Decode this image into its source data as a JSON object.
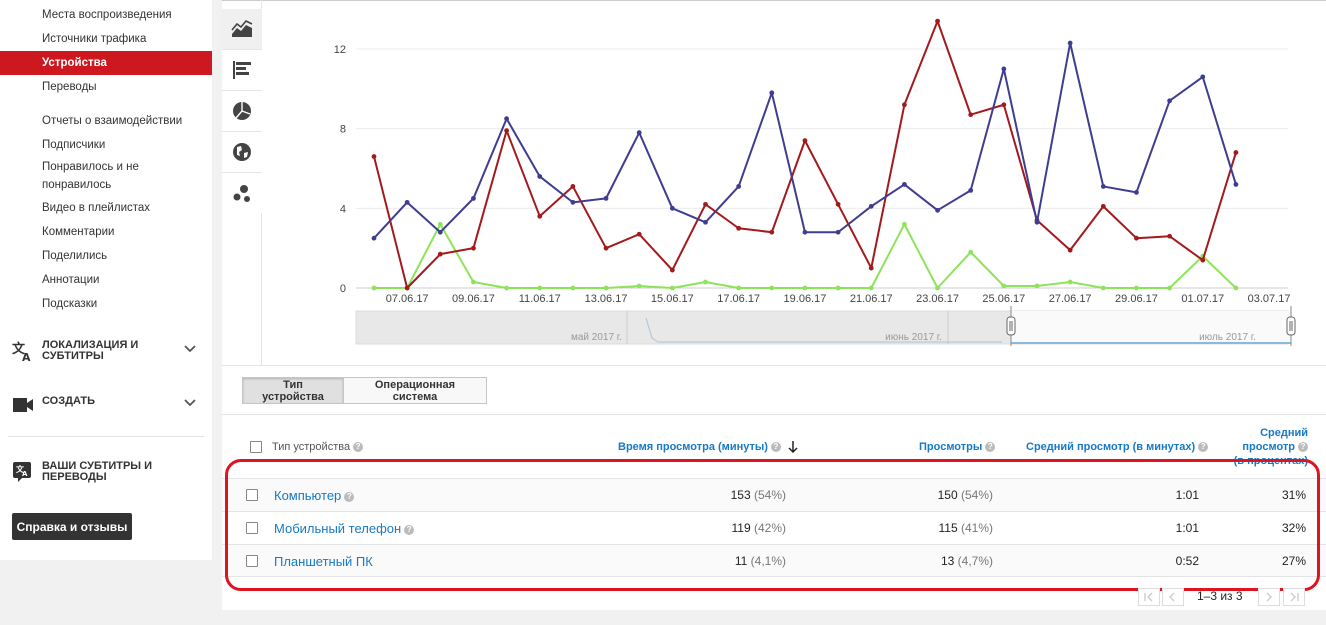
{
  "sidebar": {
    "items_top": [
      {
        "label": "Места воспроизведения"
      },
      {
        "label": "Источники трафика"
      },
      {
        "label": "Устройства"
      },
      {
        "label": "Переводы"
      }
    ],
    "engagement_heading": "Отчеты о взаимодействии",
    "engagement_items": [
      {
        "label": "Подписчики"
      },
      {
        "label": "Понравилось и не понравилось"
      },
      {
        "label": "Видео в плейлистах"
      },
      {
        "label": "Комментарии"
      },
      {
        "label": "Поделились"
      },
      {
        "label": "Аннотации"
      },
      {
        "label": "Подсказки"
      }
    ],
    "sections": [
      {
        "label": "Локализация и субтитры",
        "icon": "translate-icon"
      },
      {
        "label": "Создать",
        "icon": "video-camera-icon"
      },
      {
        "label": "Ваши субтитры и переводы",
        "icon": "subtitles-translate-icon"
      }
    ],
    "help_button": "Справка и отзывы"
  },
  "view_tabs": [
    "line-chart-icon",
    "bar-chart-icon",
    "pie-chart-icon",
    "globe-icon",
    "bubble-chart-icon"
  ],
  "chart_data": {
    "type": "line",
    "x": [
      "06.06.17",
      "07.06.17",
      "08.06.17",
      "09.06.17",
      "10.06.17",
      "11.06.17",
      "12.06.17",
      "13.06.17",
      "14.06.17",
      "15.06.17",
      "16.06.17",
      "17.06.17",
      "18.06.17",
      "19.06.17",
      "20.06.17",
      "21.06.17",
      "22.06.17",
      "23.06.17",
      "24.06.17",
      "25.06.17",
      "26.06.17",
      "27.06.17",
      "28.06.17",
      "29.06.17",
      "30.06.17",
      "01.07.17",
      "02.07.17",
      "03.07.17"
    ],
    "xticks": [
      "07.06.17",
      "09.06.17",
      "11.06.17",
      "13.06.17",
      "15.06.17",
      "17.06.17",
      "19.06.17",
      "21.06.17",
      "23.06.17",
      "25.06.17",
      "27.06.17",
      "29.06.17",
      "01.07.17",
      "03.07.17"
    ],
    "yticks": [
      0,
      4,
      8,
      12
    ],
    "ylim": [
      0,
      13.5
    ],
    "grid": true,
    "series": [
      {
        "color": "#3f3d8f",
        "values": [
          2.5,
          4.3,
          2.8,
          4.5,
          8.5,
          5.6,
          4.3,
          4.5,
          7.8,
          4.0,
          3.3,
          5.1,
          9.8,
          2.8,
          2.8,
          4.1,
          5.2,
          3.9,
          4.9,
          11.0,
          3.3,
          12.3,
          5.1,
          4.8,
          9.4,
          10.6,
          5.2
        ]
      },
      {
        "color": "#a31a1d",
        "values": [
          6.6,
          0,
          1.7,
          2.0,
          7.9,
          3.6,
          5.1,
          2.0,
          2.7,
          0.9,
          4.2,
          3.0,
          2.8,
          7.4,
          4.2,
          1.0,
          9.2,
          13.4,
          8.7,
          9.2,
          3.4,
          1.9,
          4.1,
          2.5,
          2.6,
          1.4,
          6.8
        ]
      },
      {
        "color": "#8fe35a",
        "values": [
          0,
          0,
          3.2,
          0.3,
          0,
          0,
          0,
          0,
          0.1,
          0,
          0.3,
          0,
          0,
          0,
          0,
          0,
          3.2,
          0,
          1.8,
          0.1,
          0.1,
          0.3,
          0,
          0,
          0,
          1.6,
          0
        ]
      }
    ],
    "navigator_labels": [
      "май 2017 г.",
      "июнь 2017 г.",
      "июль 2017 г."
    ]
  },
  "segments": {
    "device_type": "Тип устройства",
    "os": "Операционная система"
  },
  "table": {
    "headers": {
      "device": "Тип устройства",
      "watch_time": "Время просмотра (минуты)",
      "views": "Просмотры",
      "avg_view": "Средний просмотр (в минутах)",
      "avg_pct_line1": "Средний",
      "avg_pct_line2": "просмотр",
      "avg_pct_line3": "(в процентах)"
    },
    "rows": [
      {
        "name": "Компьютер",
        "watch": "153",
        "watch_pct": "(54%)",
        "views": "150",
        "views_pct": "(54%)",
        "avg": "1:01",
        "pct": "31%"
      },
      {
        "name": "Мобильный телефон",
        "watch": "119",
        "watch_pct": "(42%)",
        "views": "115",
        "views_pct": "(41%)",
        "avg": "1:01",
        "pct": "32%"
      },
      {
        "name": "Планшетный ПК",
        "watch": "11",
        "watch_pct": "(4,1%)",
        "views": "13",
        "views_pct": "(4,7%)",
        "avg": "0:52",
        "pct": "27%"
      }
    ]
  },
  "pager": {
    "text": "1–3 из 3"
  },
  "colors": {
    "accent": "#cc181e",
    "link": "#167ac6",
    "highlight": "#e0141e"
  }
}
